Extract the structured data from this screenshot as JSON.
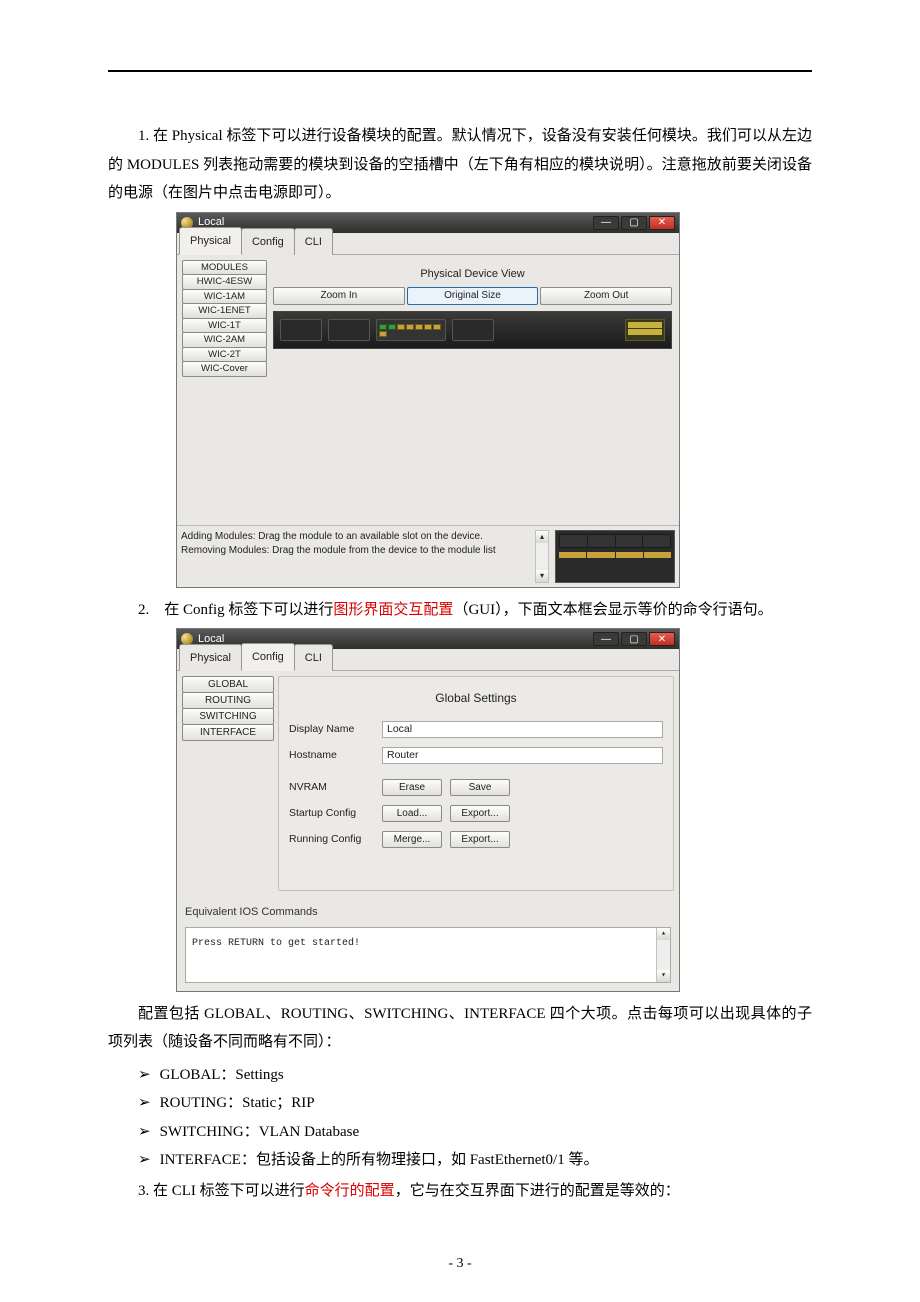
{
  "para1": "1. 在 Physical 标签下可以进行设备模块的配置。默认情况下，设备没有安装任何模块。我们可以从左边的 MODULES 列表拖动需要的模块到设备的空插槽中（左下角有相应的模块说明）。注意拖放前要关闭设备的电源（在图片中点击电源即可）。",
  "fig1": {
    "title": "Local",
    "tabs": [
      "Physical",
      "Config",
      "CLI"
    ],
    "modules_header": "MODULES",
    "modules": [
      "HWIC-4ESW",
      "WIC-1AM",
      "WIC-1ENET",
      "WIC-1T",
      "WIC-2AM",
      "WIC-2T",
      "WIC-Cover"
    ],
    "device_header": "Physical Device View",
    "zoom": [
      "Zoom In",
      "Original Size",
      "Zoom Out"
    ],
    "foot_add": "Adding Modules: Drag the module to an available slot on the device.",
    "foot_rem": "Removing Modules: Drag the module from the device to the module list"
  },
  "para2_a": "2.　在 Config 标签下可以进行",
  "para2_red": "图形界面交互配置",
  "para2_b": "（GUI），下面文本框会显示等价的命令行语句。",
  "fig2": {
    "title": "Local",
    "tabs": [
      "Physical",
      "Config",
      "CLI"
    ],
    "left": [
      "GLOBAL",
      "ROUTING",
      "SWITCHING",
      "INTERFACE"
    ],
    "heading": "Global Settings",
    "display_name_label": "Display Name",
    "display_name_value": "Local",
    "hostname_label": "Hostname",
    "hostname_value": "Router",
    "nvram_label": "NVRAM",
    "nvram_btns": [
      "Erase",
      "Save"
    ],
    "startup_label": "Startup Config",
    "startup_btns": [
      "Load...",
      "Export..."
    ],
    "running_label": "Running Config",
    "running_btns": [
      "Merge...",
      "Export..."
    ],
    "ios_label": "Equivalent IOS Commands",
    "ios_text": "Press RETURN to get started!"
  },
  "para3": "配置包括 GLOBAL、ROUTING、SWITCHING、INTERFACE 四个大项。点击每项可以出现具体的子项列表（随设备不同而略有不同）：",
  "bullets": [
    "GLOBAL：Settings",
    "ROUTING：Static；RIP",
    "SWITCHING：VLAN Database",
    "INTERFACE：包括设备上的所有物理接口，如 FastEthernet0/1 等。"
  ],
  "para4_a": "3. 在 CLI 标签下可以进行",
  "para4_red": "命令行的配置",
  "para4_b": "，它与在交互界面下进行的配置是等效的：",
  "page_number": "- 3 -"
}
